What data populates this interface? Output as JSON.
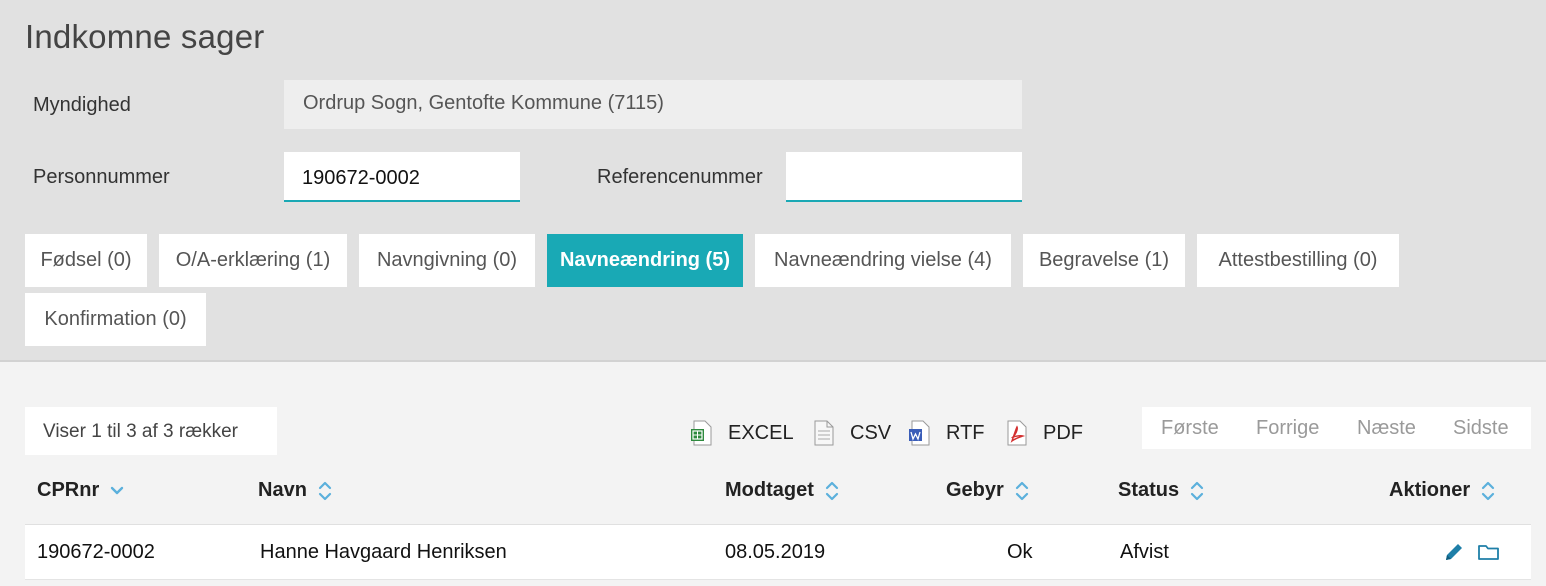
{
  "page_title": "Indkomne sager",
  "filters": {
    "myndighed_label": "Myndighed",
    "myndighed_value": "Ordrup Sogn, Gentofte Kommune (7115)",
    "personnummer_label": "Personnummer",
    "personnummer_value": "190672-0002",
    "referencenummer_label": "Referencenummer",
    "referencenummer_value": ""
  },
  "tabs": [
    {
      "label": "Fødsel (0)"
    },
    {
      "label": "O/A-erklæring (1)"
    },
    {
      "label": "Navngivning (0)"
    },
    {
      "label": "Navneændring (5)"
    },
    {
      "label": "Navneændring vielse (4)"
    },
    {
      "label": "Begravelse (1)"
    },
    {
      "label": "Attestbestilling (0)"
    },
    {
      "label": "Konfirmation (0)"
    }
  ],
  "active_tab": "Navneændring (5)",
  "table_info": "Viser 1 til 3 af 3 rækker",
  "exports": [
    {
      "label": "EXCEL",
      "icon": "excel-icon"
    },
    {
      "label": "CSV",
      "icon": "csv-icon"
    },
    {
      "label": "RTF",
      "icon": "rtf-icon"
    },
    {
      "label": "PDF",
      "icon": "pdf-icon"
    }
  ],
  "pagination": {
    "first": "Første",
    "prev": "Forrige",
    "next": "Næste",
    "last": "Sidste"
  },
  "columns": [
    "CPRnr",
    "Navn",
    "Modtaget",
    "Gebyr",
    "Status",
    "Aktioner"
  ],
  "rows": [
    {
      "cpr": "190672-0002",
      "navn": "Hanne Havgaard Henriksen",
      "modtaget": "08.05.2019",
      "gebyr": "Ok",
      "status": "Afvist"
    }
  ],
  "colors": {
    "accent": "#19a9b5",
    "sort_icon": "#5bb0dc",
    "action_icon": "#1e7fa8"
  }
}
